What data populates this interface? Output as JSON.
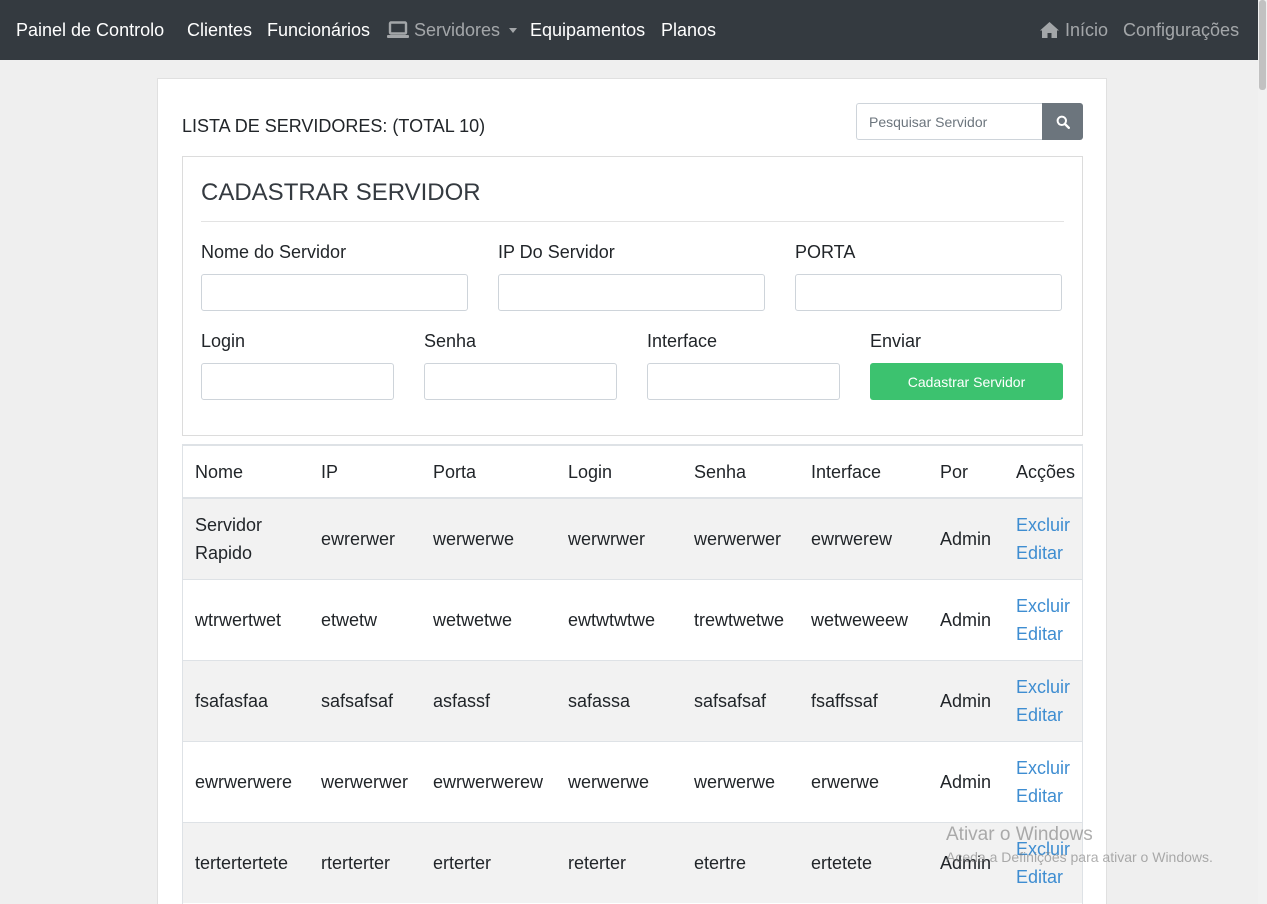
{
  "navbar": {
    "brand": "Painel de Controlo",
    "items": [
      {
        "label": "Clientes"
      },
      {
        "label": "Funcionários"
      },
      {
        "label": "Servidores"
      },
      {
        "label": "Equipamentos"
      },
      {
        "label": "Planos"
      }
    ],
    "right": [
      {
        "label": "Início"
      },
      {
        "label": "Configurações"
      }
    ]
  },
  "list": {
    "title": "LISTA DE SERVIDORES: (TOTAL 10)",
    "search_placeholder": "Pesquisar Servidor"
  },
  "form": {
    "title": "CADASTRAR SERVIDOR",
    "labels": {
      "name": "Nome do Servidor",
      "ip": "IP Do Servidor",
      "port": "PORTA",
      "login": "Login",
      "password": "Senha",
      "interface": "Interface",
      "send": "Enviar"
    },
    "submit_label": "Cadastrar Servidor",
    "submit_color": "#3cc26f"
  },
  "table": {
    "headers": [
      "Nome",
      "IP",
      "Porta",
      "Login",
      "Senha",
      "Interface",
      "Por",
      "Acções"
    ],
    "action_delete": "Excluir",
    "action_edit": "Editar",
    "rows": [
      [
        "Servidor Rapido",
        "ewrerwer",
        "werwerwe",
        "werwrwer",
        "werwerwer",
        "ewrwerew",
        "Admin"
      ],
      [
        "wtrwertwet",
        "etwetw",
        "wetwetwe",
        "ewtwtwtwe",
        "trewtwetwe",
        "wetweweew",
        "Admin"
      ],
      [
        "fsafasfaa",
        "safsafsaf",
        "asfassf",
        "safassa",
        "safsafsaf",
        "fsaffssaf",
        "Admin"
      ],
      [
        "ewrwerwere",
        "werwerwer",
        "ewrwerwerew",
        "werwerwe",
        "werwerwe",
        "erwerwe",
        "Admin"
      ],
      [
        "tertertertete",
        "rterterter",
        "erterter",
        "reterter",
        "etertre",
        "ertetete",
        "Admin"
      ]
    ]
  },
  "watermark": {
    "line1": "Ativar o Windows",
    "line2": "Aceda a Definições para ativar o Windows."
  }
}
